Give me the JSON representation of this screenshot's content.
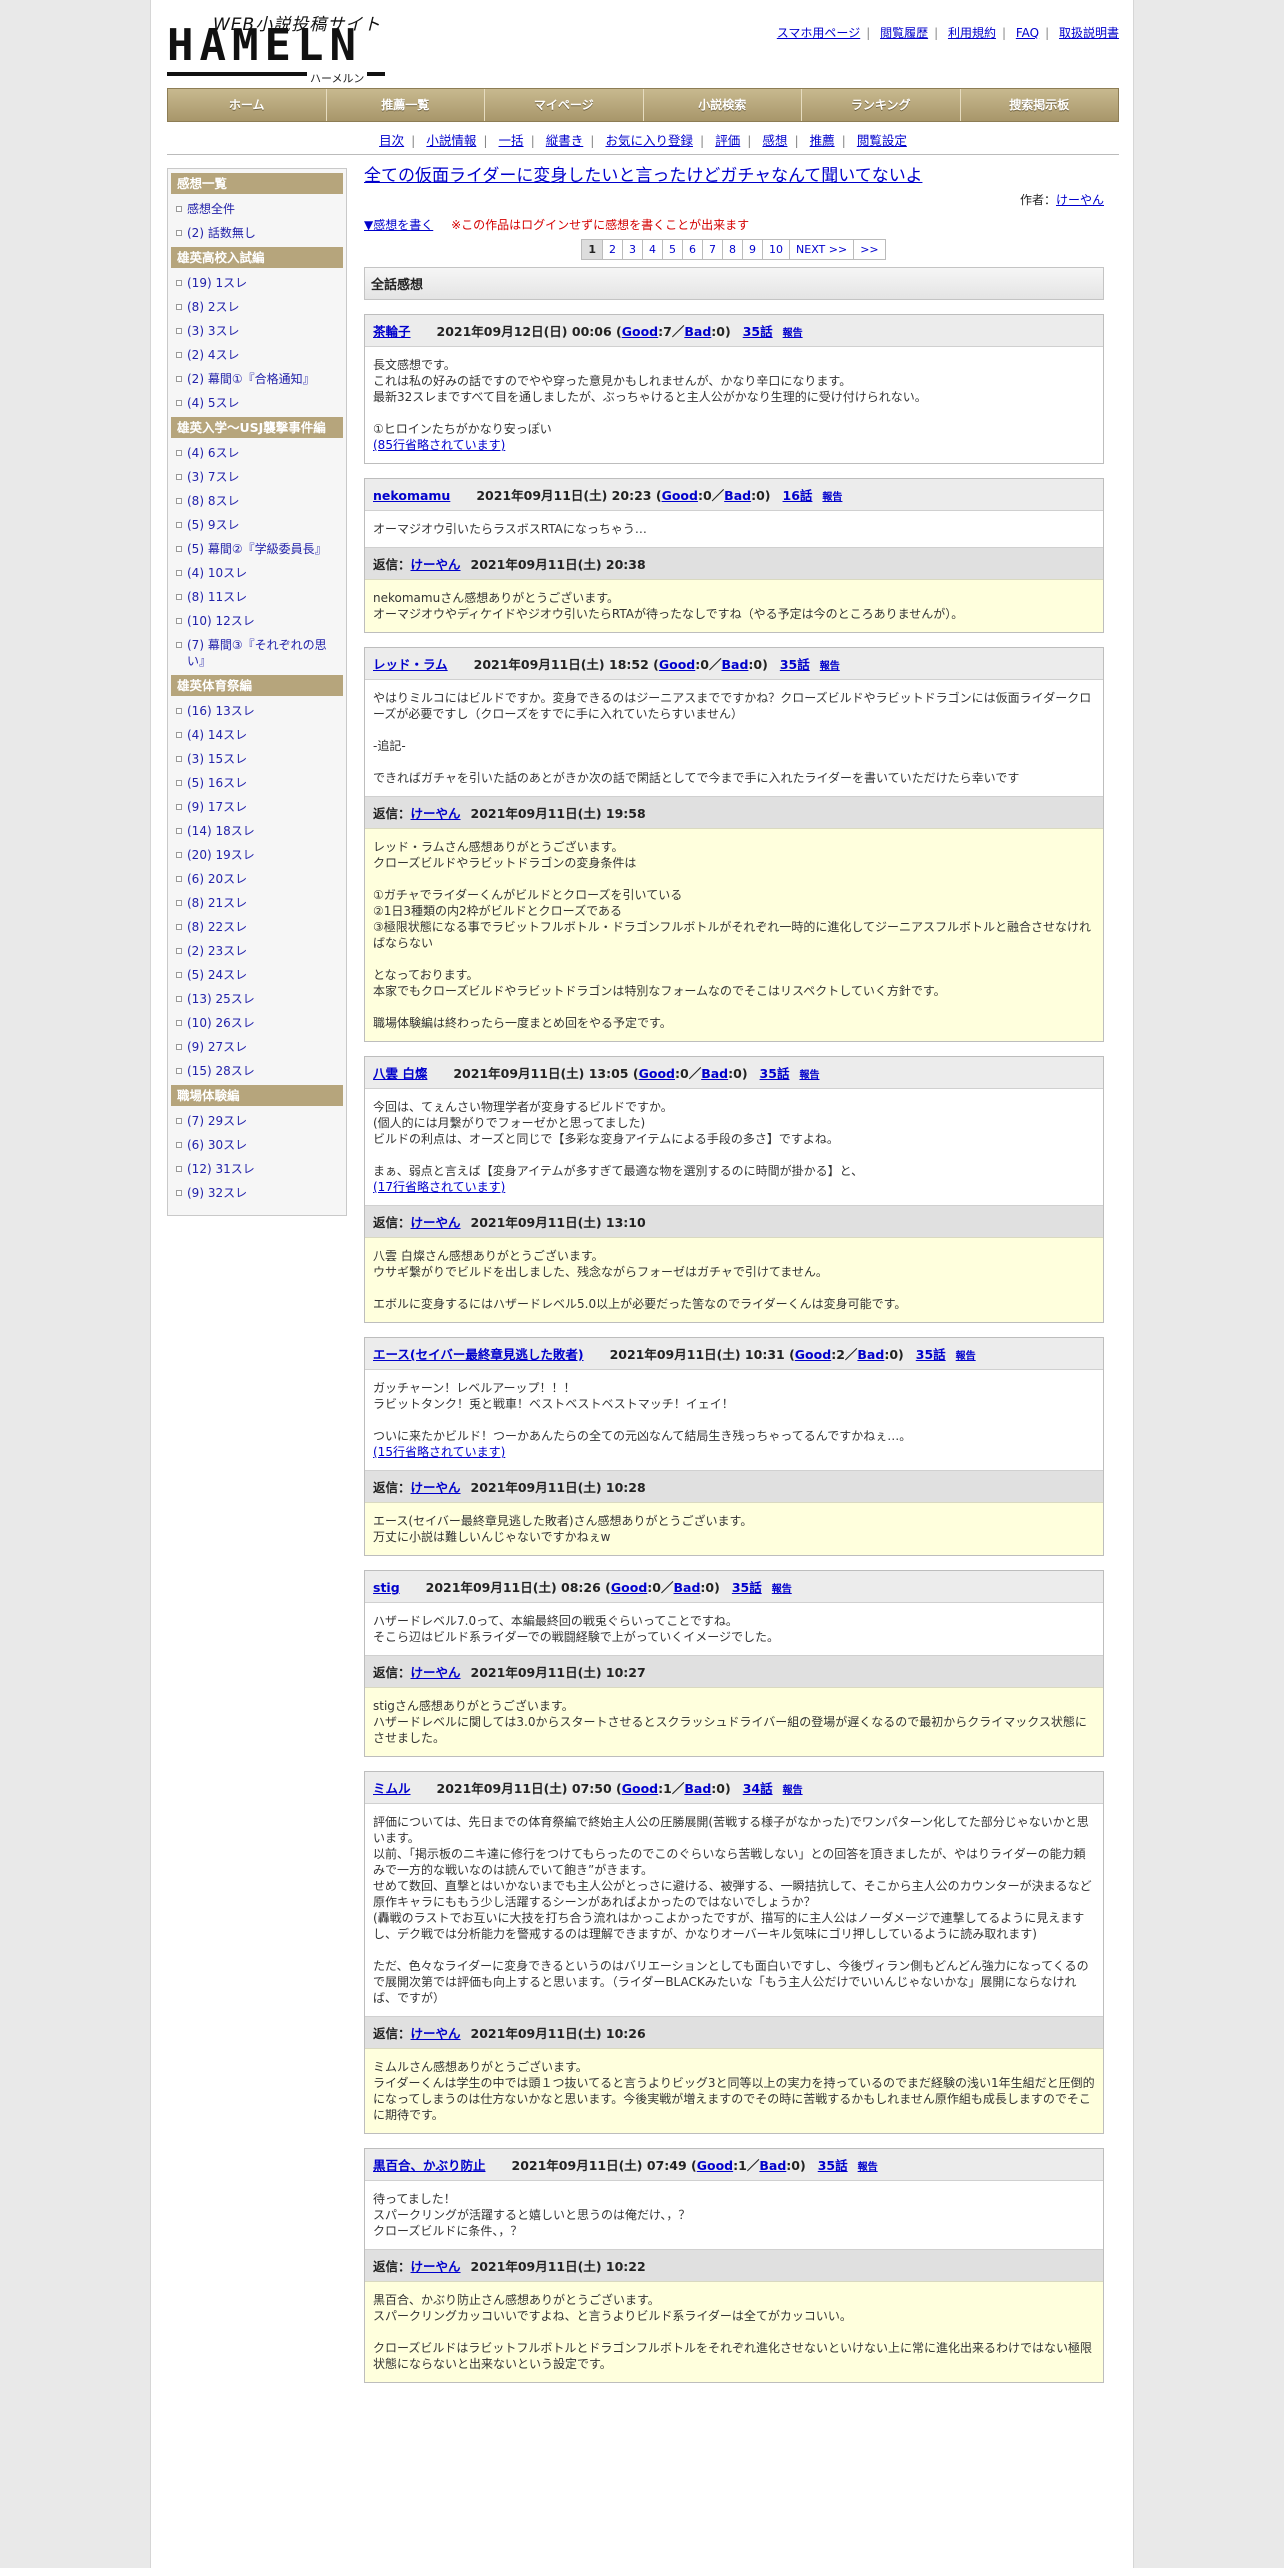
{
  "logo": {
    "top": "WEB小説投稿サイト",
    "main": "HAMELN",
    "kana": "ハーメルン"
  },
  "toplinks": [
    "スマホ用ページ",
    "閲覧履歴",
    "利用規約",
    "FAQ",
    "取扱説明書"
  ],
  "mainnav": [
    "ホーム",
    "推薦一覧",
    "マイページ",
    "小説検索",
    "ランキング",
    "捜索掲示板"
  ],
  "subnav": [
    "目次",
    "小説情報",
    "一括",
    "縦書き",
    "お気に入り登録",
    "評価",
    "感想",
    "推薦",
    "閲覧設定"
  ],
  "sidebar": {
    "sections": [
      {
        "title": "感想一覧",
        "items": [
          {
            "count": "",
            "label": "感想全件"
          },
          {
            "count": "(2)",
            "label": "話数無し"
          }
        ]
      },
      {
        "title": "雄英高校入試編",
        "items": [
          {
            "count": "(19)",
            "label": "1スレ"
          },
          {
            "count": "(8)",
            "label": "2スレ"
          },
          {
            "count": "(3)",
            "label": "3スレ"
          },
          {
            "count": "(2)",
            "label": "4スレ"
          },
          {
            "count": "(2)",
            "label": "幕間①『合格通知』"
          },
          {
            "count": "(4)",
            "label": "5スレ"
          }
        ]
      },
      {
        "title": "雄英入学〜USJ襲撃事件編",
        "items": [
          {
            "count": "(4)",
            "label": "6スレ"
          },
          {
            "count": "(3)",
            "label": "7スレ"
          },
          {
            "count": "(8)",
            "label": "8スレ"
          },
          {
            "count": "(5)",
            "label": "9スレ"
          },
          {
            "count": "(5)",
            "label": "幕間②『学級委員長』"
          },
          {
            "count": "(4)",
            "label": "10スレ"
          },
          {
            "count": "(8)",
            "label": "11スレ"
          },
          {
            "count": "(10)",
            "label": "12スレ"
          },
          {
            "count": "(7)",
            "label": "幕間③『それぞれの思い』"
          }
        ]
      },
      {
        "title": "雄英体育祭編",
        "items": [
          {
            "count": "(16)",
            "label": "13スレ"
          },
          {
            "count": "(4)",
            "label": "14スレ"
          },
          {
            "count": "(3)",
            "label": "15スレ"
          },
          {
            "count": "(5)",
            "label": "16スレ"
          },
          {
            "count": "(9)",
            "label": "17スレ"
          },
          {
            "count": "(14)",
            "label": "18スレ"
          },
          {
            "count": "(20)",
            "label": "19スレ"
          },
          {
            "count": "(6)",
            "label": "20スレ"
          },
          {
            "count": "(8)",
            "label": "21スレ"
          },
          {
            "count": "(8)",
            "label": "22スレ"
          },
          {
            "count": "(2)",
            "label": "23スレ"
          },
          {
            "count": "(5)",
            "label": "24スレ"
          },
          {
            "count": "(13)",
            "label": "25スレ"
          },
          {
            "count": "(10)",
            "label": "26スレ"
          },
          {
            "count": "(9)",
            "label": "27スレ"
          },
          {
            "count": "(15)",
            "label": "28スレ"
          }
        ]
      },
      {
        "title": "職場体験編",
        "items": [
          {
            "count": "(7)",
            "label": "29スレ"
          },
          {
            "count": "(6)",
            "label": "30スレ"
          },
          {
            "count": "(12)",
            "label": "31スレ"
          },
          {
            "count": "(9)",
            "label": "32スレ"
          }
        ]
      }
    ]
  },
  "novel": {
    "title": "全ての仮面ライダーに変身したいと言ったけどガチャなんて聞いてないよ",
    "author_label": "作者：",
    "author": "けーやん",
    "write_link": "▼感想を書く",
    "login_note": "※この作品はログインせずに感想を書くことが出来ます"
  },
  "pager": [
    "1",
    "2",
    "3",
    "4",
    "5",
    "6",
    "7",
    "8",
    "9",
    "10",
    "NEXT >>",
    ">>"
  ],
  "all_heading": "全話感想",
  "labels": {
    "good": "Good",
    "bad": "Bad",
    "report": "報告",
    "reply": "返信："
  },
  "comments": [
    {
      "name": "茶輪子",
      "date": "2021年09月12日(日) 00:06",
      "good": "7",
      "bad": "0",
      "ep": "35話",
      "body": "長文感想です。\nこれは私の好みの話ですのでやや穿った意見かもしれませんが、かなり辛口になります。\n最新32スレまですべて目を通しましたが、ぶっちゃけると主人公がかなり生理的に受け付けられない。\n\n①ヒロインたちがかなり安っぽい",
      "omit": "(85行省略されています)",
      "reply": null
    },
    {
      "name": "nekomamu",
      "date": "2021年09月11日(土) 20:23",
      "good": "0",
      "bad": "0",
      "ep": "16話",
      "body": "オーマジオウ引いたらラスボスRTAになっちゃう…",
      "omit": "",
      "reply": {
        "name": "けーやん",
        "date": "2021年09月11日(土) 20:38",
        "body": "nekomamuさん感想ありがとうございます。\nオーマジオウやディケイドやジオウ引いたらRTAが待ったなしですね（やる予定は今のところありませんが）。"
      }
    },
    {
      "name": "レッド・ラム",
      "date": "2021年09月11日(土) 18:52",
      "good": "0",
      "bad": "0",
      "ep": "35話",
      "body": "やはりミルコにはビルドですか。変身できるのはジーニアスまでですかね？クローズビルドやラビットドラゴンには仮面ライダークローズが必要ですし（クローズをすでに手に入れていたらすいません）\n\n-追記-\n\nできればガチャを引いた話のあとがきか次の話で閑話としてで今まで手に入れたライダーを書いていただけたら幸いです",
      "omit": "",
      "reply": {
        "name": "けーやん",
        "date": "2021年09月11日(土) 19:58",
        "body": "レッド・ラムさん感想ありがとうございます。\nクローズビルドやラビットドラゴンの変身条件は\n\n①ガチャでライダーくんがビルドとクローズを引いている\n②1日3種類の内2枠がビルドとクローズである\n③極限状態になる事でラビットフルボトル・ドラゴンフルボトルがそれぞれ一時的に進化してジーニアスフルボトルと融合させなければならない\n\nとなっております。\n本家でもクローズビルドやラビットドラゴンは特別なフォームなのでそこはリスペクトしていく方針です。\n\n職場体験編は終わったら一度まとめ回をやる予定です。"
      }
    },
    {
      "name": "八雲 白燦",
      "date": "2021年09月11日(土) 13:05",
      "good": "0",
      "bad": "0",
      "ep": "35話",
      "body": "今回は、てぇんさい物理学者が変身するビルドですか。\n(個人的には月繋がりでフォーゼかと思ってました)\nビルドの利点は、オーズと同じで【多彩な変身アイテムによる手段の多さ】ですよね。\n\nまぁ、弱点と言えば【変身アイテムが多すぎて最適な物を選別するのに時間が掛かる】と、",
      "omit": "(17行省略されています)",
      "reply": {
        "name": "けーやん",
        "date": "2021年09月11日(土) 13:10",
        "body": "八雲 白燦さん感想ありがとうございます。\nウサギ繋がりでビルドを出しました、残念ながらフォーゼはガチャで引けてません。\n\nエボルに変身するにはハザードレベル5.0以上が必要だった筈なのでライダーくんは変身可能です。"
      }
    },
    {
      "name": "エース(セイバー最終章見逃した敗者)",
      "date": "2021年09月11日(土) 10:31",
      "good": "2",
      "bad": "0",
      "ep": "35話",
      "body": "ガッチャーン！レベルアーップ！！！\nラビットタンク！兎と戦車！ベストベストベストマッチ！イェイ！\n\nついに来たかビルド！つーかあんたらの全ての元凶なんて結局生き残っちゃってるんですかねぇ…。",
      "omit": "(15行省略されています)",
      "reply": {
        "name": "けーやん",
        "date": "2021年09月11日(土) 10:28",
        "body": "エース(セイバー最終章見逃した敗者)さん感想ありがとうございます。\n万丈に小説は難しいんじゃないですかねぇw"
      }
    },
    {
      "name": "stig",
      "date": "2021年09月11日(土) 08:26",
      "good": "0",
      "bad": "0",
      "ep": "35話",
      "body": "ハザードレベル7.0って、本編最終回の戦兎ぐらいってことですね。\nそこら辺はビルド系ライダーでの戦闘経験で上がっていくイメージでした。",
      "omit": "",
      "reply": {
        "name": "けーやん",
        "date": "2021年09月11日(土) 10:27",
        "body": "stigさん感想ありがとうございます。\nハザードレベルに関しては3.0からスタートさせるとスクラッシュドライバー組の登場が遅くなるので最初からクライマックス状態にさせました。"
      }
    },
    {
      "name": "ミムル",
      "date": "2021年09月11日(土) 07:50",
      "good": "1",
      "bad": "0",
      "ep": "34話",
      "body": "評価については、先日までの体育祭編で終始主人公の圧勝展開(苦戦する様子がなかった)でワンパターン化してた部分じゃないかと思います。\n以前、「掲示板のニキ達に修行をつけてもらったのでこのぐらいなら苦戦しない」との回答を頂きましたが、やはりライダーの能力頼みで一方的な戦いなのは読んでいて飽き”がきます。\nせめて数回、直撃とはいかないまでも主人公がとっさに避ける、被弾する、一瞬拮抗して、そこから主人公のカウンターが決まるなど原作キャラにももう少し活躍するシーンがあればよかったのではないでしょうか？\n(轟戦のラストでお互いに大技を打ち合う流れはかっこよかったですが、描写的に主人公はノーダメージで連撃してるように見えますし、デク戦では分析能力を警戒するのは理解できますが、かなりオーバーキル気味にゴリ押ししているように読み取れます)\n\nただ、色々なライダーに変身できるというのはバリエーションとしても面白いですし、今後ヴィラン側もどんどん強力になってくるので展開次第では評価も向上すると思います。（ライダーBLACKみたいな「もう主人公だけでいいんじゃないかな」展開にならなければ、ですが）",
      "omit": "",
      "reply": {
        "name": "けーやん",
        "date": "2021年09月11日(土) 10:26",
        "body": "ミムルさん感想ありがとうございます。\nライダーくんは学生の中では頭１つ抜いてると言うよりビッグ3と同等以上の実力を持っているのでまだ経験の浅い1年生組だと圧倒的になってしまうのは仕方ないかなと思います。今後実戦が増えますのでその時に苦戦するかもしれません原作組も成長しますのでそこに期待です。"
      }
    },
    {
      "name": "黒百合、かぶり防止",
      "date": "2021年09月11日(土) 07:49",
      "good": "1",
      "bad": "0",
      "ep": "35話",
      "body": "待ってました！\nスパークリングが活躍すると嬉しいと思うのは俺だけ、，？\nクローズビルドに条件、，？",
      "omit": "",
      "reply": {
        "name": "けーやん",
        "date": "2021年09月11日(土) 10:22",
        "body": "黒百合、かぶり防止さん感想ありがとうございます。\nスパークリングカッコいいですよね、と言うよりビルド系ライダーは全てがカッコいい。\n\nクローズビルドはラビットフルボトルとドラゴンフルボトルをそれぞれ進化させないといけない上に常に進化出来るわけではない極限状態にならないと出来ないという設定です。"
      }
    }
  ]
}
